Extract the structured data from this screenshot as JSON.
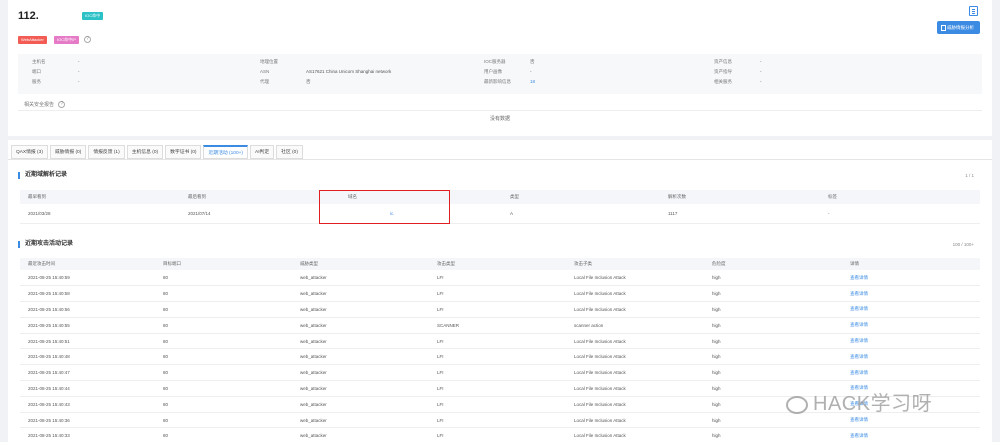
{
  "header": {
    "ip": "112.",
    "ioc_badge": "IOC命中",
    "tags": [
      "WebAttacker",
      "IOC命中IP"
    ],
    "report_button": "威胁情报分析",
    "related_reports": "相关安全报告",
    "no_data": "没有数据"
  },
  "info": {
    "col1": [
      {
        "k": "主机名",
        "v": "-"
      },
      {
        "k": "端口",
        "v": "-"
      },
      {
        "k": "服务",
        "v": "-"
      }
    ],
    "col2": [
      {
        "k": "地理位置",
        "v": ""
      },
      {
        "k": "ASN",
        "v": "AS17621 China Unicom Shanghai network"
      },
      {
        "k": "代理",
        "v": "否"
      }
    ],
    "col3": [
      {
        "k": "IOC服务器",
        "v": "否"
      },
      {
        "k": "用户画像",
        "v": "-"
      },
      {
        "k": "最新影响信息",
        "v": "18"
      }
    ],
    "col4": [
      {
        "k": "资产信息",
        "v": "-"
      },
      {
        "k": "资产指导",
        "v": "-"
      },
      {
        "k": "相关服务",
        "v": "-"
      }
    ]
  },
  "tabs": [
    "QAX情报 (3)",
    "威胁情报 (0)",
    "情报反馈 (1)",
    "主机信息 (0)",
    "数字证书 (0)",
    "近期活动 (100+)",
    "AI判定",
    "社区 (0)"
  ],
  "active_tab_index": 5,
  "dns_section": {
    "title": "近期域解析记录",
    "pager": "1 / 1",
    "columns": [
      "最早看到",
      "最后看到",
      "域名",
      "类型",
      "解析次数",
      "标签"
    ],
    "rows": [
      [
        "2021/03/28",
        "2021/07/14",
        "ic.",
        "A",
        "1117",
        "-"
      ]
    ]
  },
  "attack_section": {
    "title": "近期攻击活动记录",
    "pager": "100 / 100+",
    "columns": [
      "最近攻击时间",
      "目标端口",
      "威胁类型",
      "攻击类型",
      "攻击子类",
      "危险度",
      "详情"
    ],
    "rows": [
      [
        "2021-08-25 15:40:59",
        "80",
        "web_attacker",
        "LFI",
        "Local File Inclusion Attack",
        "high",
        "查看详情"
      ],
      [
        "2021-08-25 15:40:58",
        "80",
        "web_attacker",
        "LFI",
        "Local File Inclusion Attack",
        "high",
        "查看详情"
      ],
      [
        "2021-08-25 15:40:56",
        "80",
        "web_attacker",
        "LFI",
        "Local File Inclusion Attack",
        "high",
        "查看详情"
      ],
      [
        "2021-08-25 15:40:55",
        "80",
        "web_attacker",
        "SCANNER",
        "scanner action",
        "high",
        "查看详情"
      ],
      [
        "2021-08-25 15:40:51",
        "80",
        "web_attacker",
        "LFI",
        "Local File Inclusion Attack",
        "high",
        "查看详情"
      ],
      [
        "2021-08-25 15:40:48",
        "80",
        "web_attacker",
        "LFI",
        "Local File Inclusion Attack",
        "high",
        "查看详情"
      ],
      [
        "2021-08-25 15:40:47",
        "80",
        "web_attacker",
        "LFI",
        "Local File Inclusion Attack",
        "high",
        "查看详情"
      ],
      [
        "2021-08-25 15:40:44",
        "80",
        "web_attacker",
        "LFI",
        "Local File Inclusion Attack",
        "high",
        "查看详情"
      ],
      [
        "2021-08-25 15:40:43",
        "80",
        "web_attacker",
        "LFI",
        "Local File Inclusion Attack",
        "high",
        "查看详情"
      ],
      [
        "2021-08-25 15:40:36",
        "80",
        "web_attacker",
        "LFI",
        "Local File Inclusion Attack",
        "high",
        "查看详情"
      ],
      [
        "2021-08-25 15:40:33",
        "80",
        "web_attacker",
        "LFI",
        "Local File Inclusion Attack",
        "high",
        "查看详情"
      ]
    ]
  },
  "watermark": "HACK学习呀",
  "colors": {
    "accent": "#3b8be3",
    "highlight_box": "#e02020"
  }
}
